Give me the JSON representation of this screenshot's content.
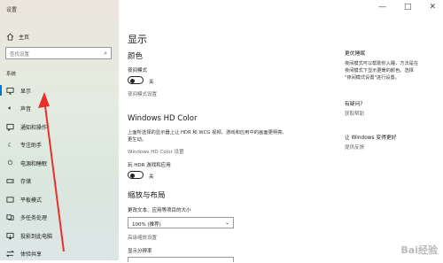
{
  "window": {
    "title": "设置",
    "controls": [
      "—",
      "□",
      "✕"
    ]
  },
  "sidebar": {
    "home": "主页",
    "search_placeholder": "查找设置",
    "section": "系统",
    "items": [
      {
        "label": "显示",
        "icon": "monitor-icon"
      },
      {
        "label": "声音",
        "icon": "speaker-icon"
      },
      {
        "label": "通知和操作",
        "icon": "notification-icon"
      },
      {
        "label": "专注助手",
        "icon": "moon-icon"
      },
      {
        "label": "电源和睡眠",
        "icon": "power-icon"
      },
      {
        "label": "存储",
        "icon": "storage-icon"
      },
      {
        "label": "平板模式",
        "icon": "tablet-icon"
      },
      {
        "label": "多任务处理",
        "icon": "multitask-icon"
      },
      {
        "label": "投影到此电脑",
        "icon": "project-icon"
      },
      {
        "label": "体验共享",
        "icon": "share-icon"
      }
    ]
  },
  "main": {
    "title": "显示",
    "color_heading": "颜色",
    "night_light_label": "夜间模式",
    "night_light_state": "关",
    "night_light_settings": "夜间模式设置",
    "hdr_heading": "Windows HD Color",
    "hdr_desc_1": "上面所选择的显示器上让 HDR 和 WCG 视频、游戏和应用中的画面更明亮、",
    "hdr_desc_2": "更生动。",
    "hdr_settings": "Windows HD Color 设置",
    "hdr_toggle_label": "玩 HDR 游戏和应用",
    "hdr_state": "关",
    "scale_heading": "缩放与布局",
    "scale_label": "更改文本、应用等项目的大小",
    "scale_value": "100% (推荐)",
    "advanced_scale": "高级缩放设置",
    "resolution_label": "显示分辨率"
  },
  "right": {
    "sleep_title": "更优睡眠",
    "sleep_desc_1": "夜间模式可以帮助你入睡，方法是在",
    "sleep_desc_2": "夜间模式下显示更暖的颜色。选择",
    "sleep_desc_3": "\"夜间模式设置\"进行设置。",
    "help_title": "有疑问?",
    "help_link": "获取帮助",
    "improve_title": "让 Windows 变得更好",
    "improve_link": "提供反馈"
  },
  "watermark": "Bai经验"
}
